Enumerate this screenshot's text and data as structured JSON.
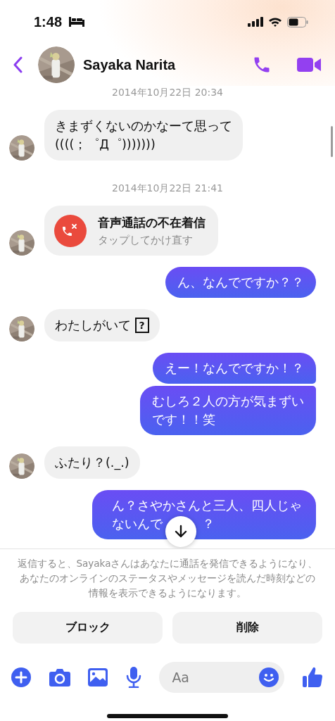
{
  "status_bar": {
    "time": "1:48"
  },
  "header": {
    "name": "Sayaka Narita"
  },
  "messages": [
    {
      "kind": "timestamp",
      "text": "2014年10月22日 20:34"
    },
    {
      "kind": "incoming",
      "text": "きまずくないのかなーて思って\n((((；゜Д゜)))))))"
    },
    {
      "kind": "timestamp",
      "text": "2014年10月22日 21:41"
    },
    {
      "kind": "missed_call",
      "title": "音声通話の不在着信",
      "subtitle": "タップしてかけ直す"
    },
    {
      "kind": "outgoing",
      "text": "ん、なんでですか？？"
    },
    {
      "kind": "incoming",
      "text": "わたしがいて",
      "unknown_glyph": "?"
    },
    {
      "kind": "outgoing",
      "text": "えー！なんでですか！？"
    },
    {
      "kind": "outgoing",
      "text": "むしろ２人の方が気まずいです！！笑"
    },
    {
      "kind": "incoming",
      "text": "ふたり？(._.)"
    },
    {
      "kind": "outgoing",
      "lines": [
        "ん？さやかさんと三人、四人じゃ",
        "ないんで"
      ],
      "tail": "？"
    }
  ],
  "footer": {
    "notice": "返信すると、Sayakaさんはあなたに通話を発信できるようになり、あなたのオンラインのステータスやメッセージを読んだ時刻などの情報を表示できるようになります。",
    "buttons": [
      "ブロック",
      "削除"
    ],
    "composer": {
      "placeholder": "Aa"
    }
  }
}
